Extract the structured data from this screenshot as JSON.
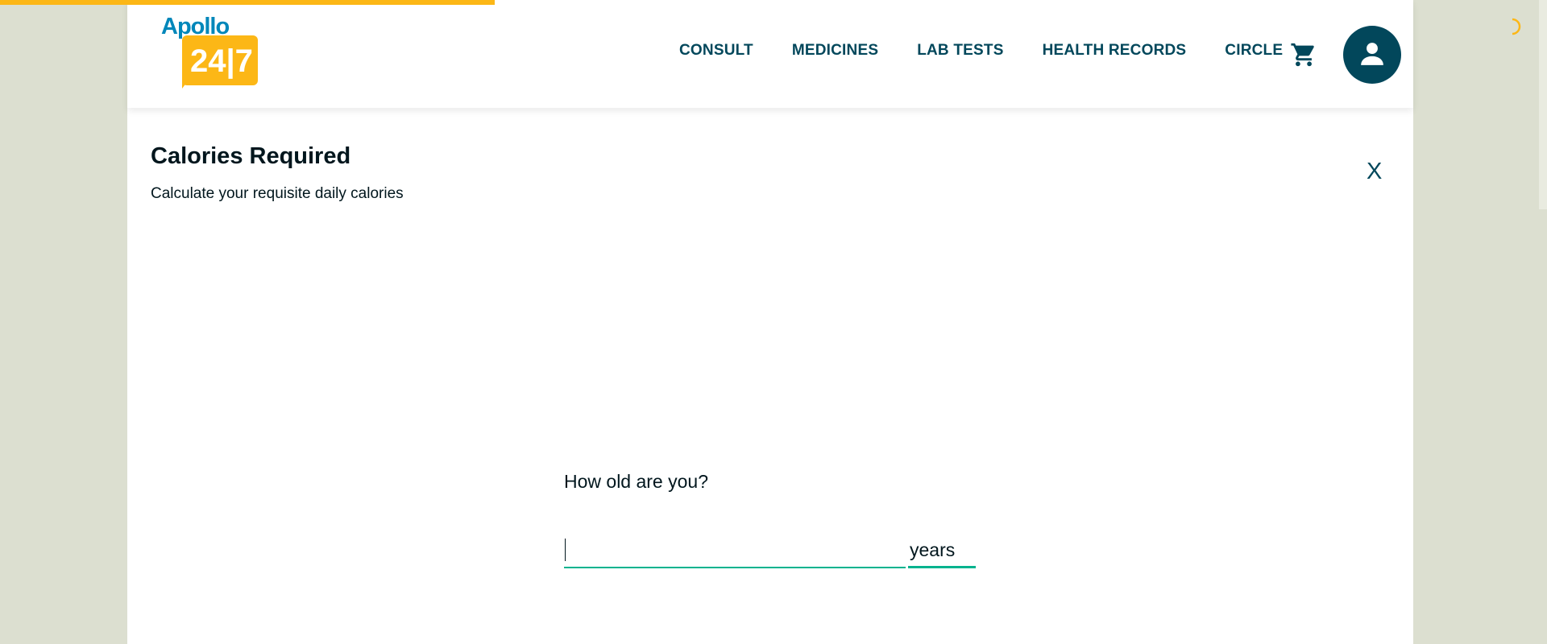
{
  "brand": {
    "logo_word": "Apollo",
    "logo_number": "24|7",
    "primary_color": "#02475b",
    "accent_color": "#fcb716",
    "logo_color": "#0087ba",
    "input_underline_color": "#00b38e"
  },
  "nav": {
    "items": [
      {
        "label": "CONSULT"
      },
      {
        "label": "MEDICINES"
      },
      {
        "label": "LAB TESTS"
      },
      {
        "label": "HEALTH RECORDS"
      },
      {
        "label": "CIRCLE"
      }
    ],
    "cart_icon": "shopping-cart-icon",
    "profile_icon": "user-icon"
  },
  "page": {
    "title": "Calories Required",
    "subtitle": "Calculate your requisite daily calories",
    "close_label": "X"
  },
  "form": {
    "question": "How old are you?",
    "age_value": "",
    "age_unit": "years"
  },
  "loading": {
    "progress_fraction": 0.32
  }
}
